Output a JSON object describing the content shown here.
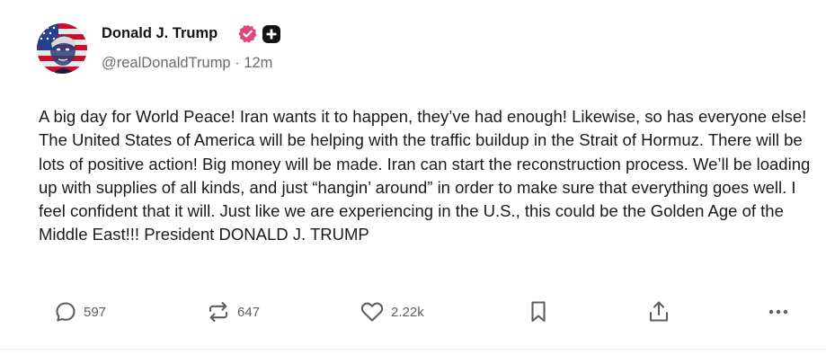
{
  "post": {
    "author": {
      "display_name": "Donald J. Trump",
      "handle": "@realDonaldTrump",
      "separator": "·",
      "time_ago": "12m",
      "verified_badge_color": "#e5467a",
      "plus_badge_color": "#141414"
    },
    "body": "A big day for World Peace! Iran wants it to happen, they’ve had enough! Likewise, so has everyone else! The United States of America will be helping with the traffic buildup in the Strait of Hormuz. There will be lots of positive action! Big money will be made. Iran can start the reconstruction process. We’ll be loading up with supplies of all kinds, and just “hangin’ around” in order to make sure that everything goes well. I feel confident that it will. Just like we are experiencing in the U.S., this could be the Golden Age of the Middle East!!! President DONALD J. TRUMP",
    "actions": {
      "reply_count": "597",
      "retruth_count": "647",
      "like_count": "2.22k",
      "icons": [
        "reply-icon",
        "retruth-icon",
        "like-icon",
        "bookmark-icon",
        "share-icon",
        "more-icon"
      ]
    }
  },
  "colors": {
    "text_primary": "#1a1a1a",
    "text_secondary": "#6b6b6b",
    "icon_gray": "#5e5e5e",
    "divider": "#ececec"
  }
}
